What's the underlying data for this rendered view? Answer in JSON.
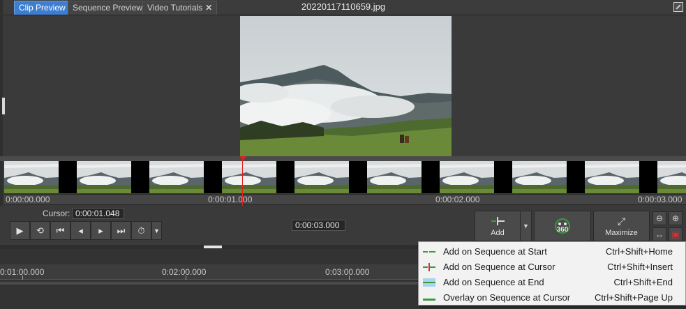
{
  "tabs": [
    {
      "label": "Clip Preview",
      "active": true
    },
    {
      "label": "Sequence Preview",
      "active": false
    },
    {
      "label": "Video Tutorials",
      "active": false
    }
  ],
  "file_title": "20220117110659.jpg",
  "strip_ruler": [
    "0:00:00.000",
    "0:00:01.000",
    "0:00:02.000",
    "0:00:03.000"
  ],
  "cursor": {
    "label": "Cursor:",
    "value": "0:00:01.048"
  },
  "duration": "0:00:03.000",
  "buttons": {
    "add": "Add",
    "vr360": "360",
    "maximize": "Maximize"
  },
  "timeline_ruler": [
    "0:01:00.000",
    "0:02:00.000",
    "0:03:00.000"
  ],
  "menu": [
    {
      "label": "Add on Sequence at Start",
      "shortcut": "Ctrl+Shift+Home",
      "icon": "add-start-icon"
    },
    {
      "label": "Add on Sequence at Cursor",
      "shortcut": "Ctrl+Shift+Insert",
      "icon": "add-cursor-icon"
    },
    {
      "label": "Add on Sequence at End",
      "shortcut": "Ctrl+Shift+End",
      "icon": "add-end-icon"
    },
    {
      "label": "Overlay on Sequence at Cursor",
      "shortcut": "Ctrl+Shift+Page Up",
      "icon": "overlay-icon"
    }
  ],
  "colors": {
    "accent": "#3e7ed0",
    "playhead": "#e02020",
    "add_icon_green": "#3c9a3c"
  }
}
